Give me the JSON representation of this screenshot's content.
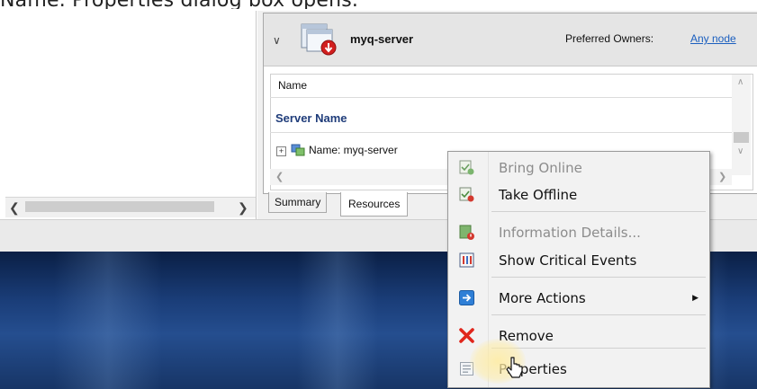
{
  "caption": "Name.   Properties dialog box opens.",
  "resource_header": {
    "title": "myq-server",
    "preferred_owners_label": "Preferred Owners:",
    "preferred_owners_value": "Any node"
  },
  "list": {
    "column_header": "Name",
    "group_heading": "Server Name",
    "rows": [
      {
        "expand": "+",
        "label": "Name: myq-server"
      }
    ]
  },
  "tabs": [
    {
      "label": "Summary",
      "active": false
    },
    {
      "label": "Resources",
      "active": true
    }
  ],
  "context_menu": {
    "items": [
      {
        "label": "Bring Online",
        "enabled": false,
        "icon": "bring-online-icon"
      },
      {
        "label": "Take Offline",
        "enabled": true,
        "icon": "take-offline-icon"
      },
      {
        "label": "Information Details...",
        "enabled": false,
        "icon": "information-details-icon"
      },
      {
        "label": "Show Critical Events",
        "enabled": true,
        "icon": "critical-events-icon"
      },
      {
        "label": "More Actions",
        "enabled": true,
        "icon": "more-actions-icon",
        "submenu": true
      },
      {
        "label": "Remove",
        "enabled": true,
        "icon": "remove-icon"
      },
      {
        "label": "Properties",
        "enabled": true,
        "icon": "properties-icon",
        "hovered": true
      }
    ]
  },
  "colors": {
    "link": "#1b5fbf",
    "heading": "#1f3c7a",
    "remove": "#e0261c",
    "desktop": "#1a3d78"
  }
}
